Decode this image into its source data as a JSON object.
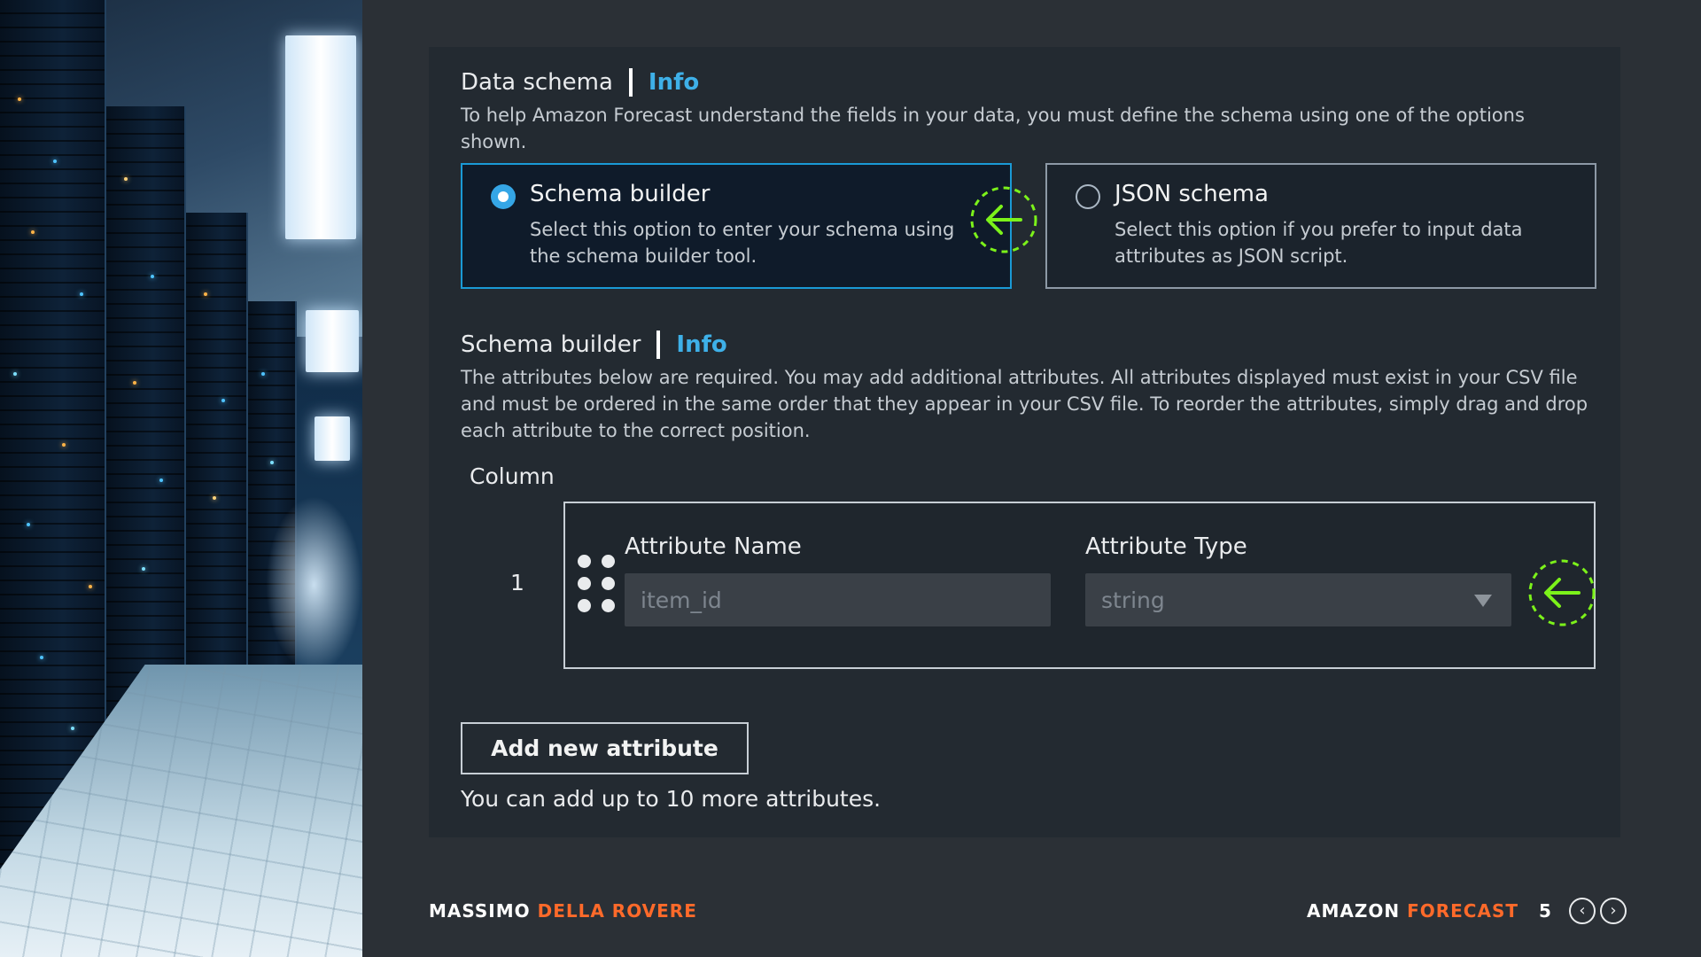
{
  "data_schema": {
    "title": "Data schema",
    "info_label": "Info",
    "description": "To help Amazon Forecast understand the fields in your data, you must define the schema using one of the options shown."
  },
  "options": [
    {
      "title": "Schema builder",
      "description": "Select this option to enter your schema using the schema builder tool.",
      "selected": true
    },
    {
      "title": "JSON schema",
      "description": "Select this option if you prefer to input data attributes as JSON script.",
      "selected": false
    }
  ],
  "schema_builder": {
    "title": "Schema builder",
    "info_label": "Info",
    "description": "The attributes below are required. You may add additional attributes. All attributes displayed must exist in your CSV file and must be ordered in the same order that they appear in your CSV file. To reorder the attributes, simply drag and drop each attribute to the correct position.",
    "column_label": "Column",
    "rows": [
      {
        "number": "1",
        "attribute_name_label": "Attribute Name",
        "attribute_name_value": "item_id",
        "attribute_type_label": "Attribute Type",
        "attribute_type_value": "string"
      }
    ],
    "add_button_label": "Add new attribute",
    "limit_text": "You can add up to 10 more attributes."
  },
  "footer": {
    "author_first": "MASSIMO",
    "author_last": "DELLA ROVERE",
    "course_first": "AMAZON",
    "course_last": "FORECAST",
    "page_number": "5",
    "prev_icon": "chevron-left-icon",
    "next_icon": "chevron-right-icon"
  },
  "colors": {
    "accent_link": "#3eb0e8",
    "selected_border": "#1a9ad6",
    "brand_orange": "#ff6a2a",
    "marker_green": "#7cf21a"
  }
}
